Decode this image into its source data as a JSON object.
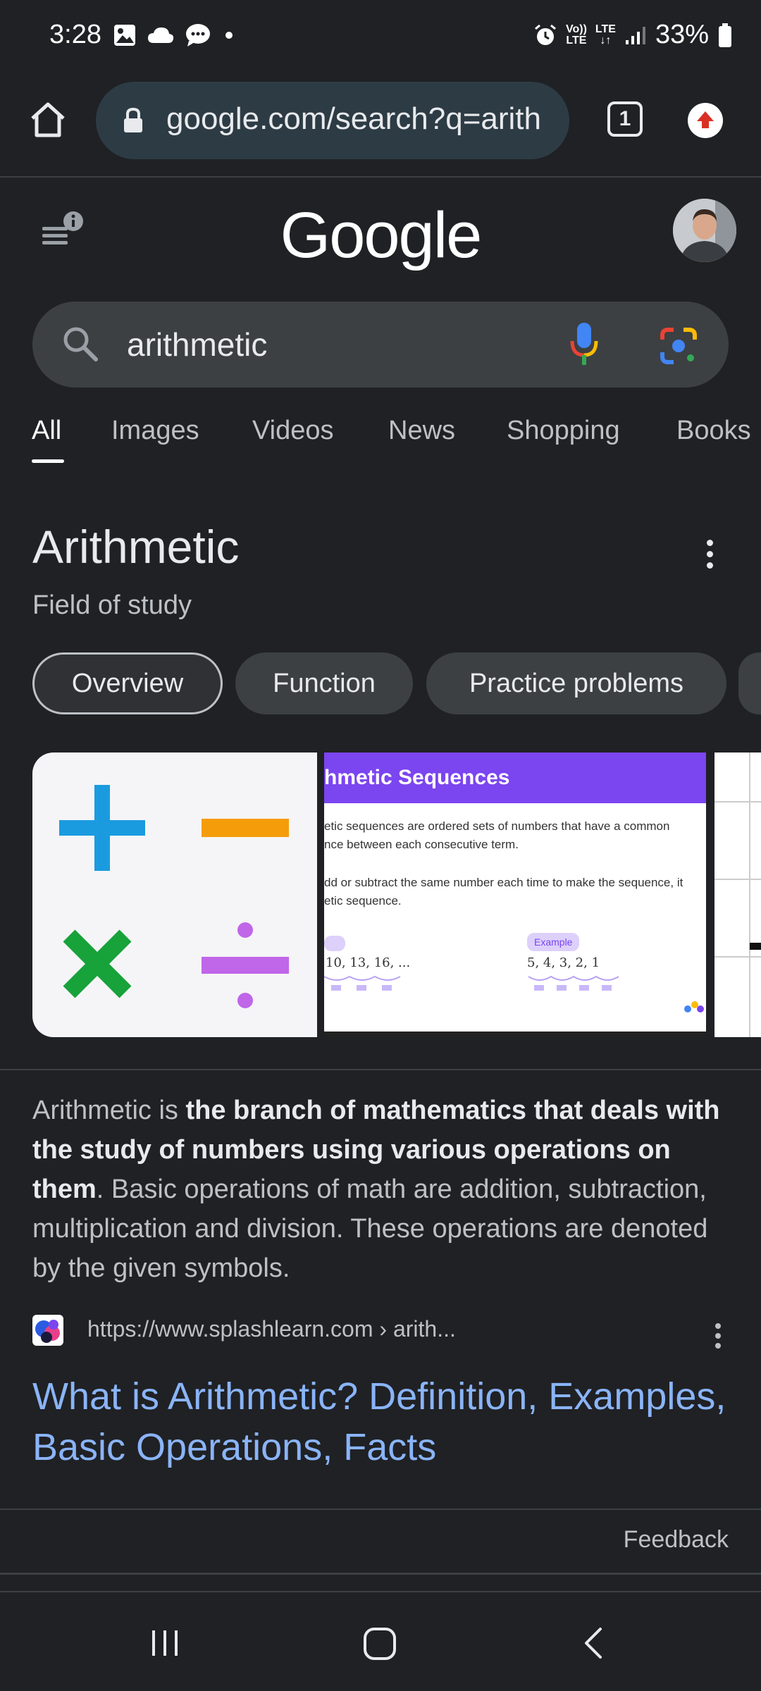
{
  "status_bar": {
    "time": "3:28",
    "battery": "33%",
    "volte_top": "Vo))",
    "volte_bottom": "LTE",
    "lte_top": "LTE",
    "lte_bottom": "↓↑"
  },
  "browser": {
    "url": "google.com/search?q=arith",
    "tab_count": "1"
  },
  "google": {
    "logo": "Google",
    "query": "arithmetic"
  },
  "tabs": [
    "All",
    "Images",
    "Videos",
    "News",
    "Shopping",
    "Books"
  ],
  "knowledge_panel": {
    "title": "Arithmetic",
    "subtitle": "Field of study",
    "chips": [
      "Overview",
      "Function",
      "Practice problems"
    ]
  },
  "image_carousel": {
    "image2": {
      "heading": "hmetic Sequences",
      "line1": "etic sequences are ordered sets of numbers that have a common",
      "line2": "nce between each consecutive term.",
      "line3": "dd or subtract the same number each time to make the sequence, it",
      "line4": "etic sequence.",
      "example_label": "Example",
      "seq1": "10, 13, 16, ...",
      "seq2": "5, 4, 3, 2, 1"
    }
  },
  "snippet": {
    "intro": "Arithmetic is ",
    "bold": "the branch of mathematics that deals with the study of numbers using various operations on them",
    "rest": ". Basic operations of math are addition, subtraction, multiplication and division. These operations are denoted by the given symbols."
  },
  "source": {
    "url": "https://www.splashlearn.com › arith...",
    "title": "What is Arithmetic? Definition, Examples, Basic Operations, Facts"
  },
  "feedback": "Feedback",
  "colors": {
    "background": "#202124",
    "link": "#8ab4f8",
    "plus": "#1a9be0",
    "minus": "#f59c0b",
    "times": "#17a23a",
    "divide": "#c066e8"
  }
}
